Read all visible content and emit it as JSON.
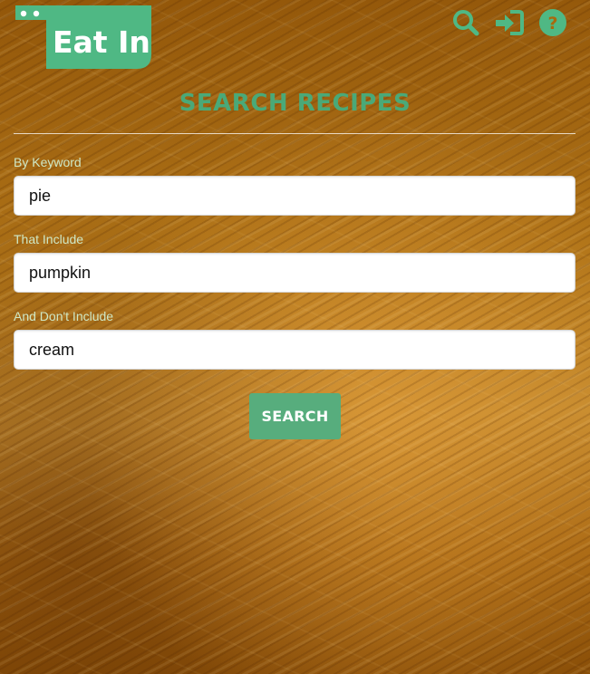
{
  "brand": {
    "logo_text": "Eat In",
    "accent_color": "#4fb884"
  },
  "header": {
    "icons": [
      "search-icon",
      "login-icon",
      "help-icon"
    ]
  },
  "page": {
    "title": "SEARCH RECIPES"
  },
  "form": {
    "keyword": {
      "label": "By Keyword",
      "value": "pie"
    },
    "include": {
      "label": "That Include",
      "value": "pumpkin"
    },
    "exclude": {
      "label": "And Don't Include",
      "value": "cream"
    },
    "submit_label": "SEARCH"
  }
}
